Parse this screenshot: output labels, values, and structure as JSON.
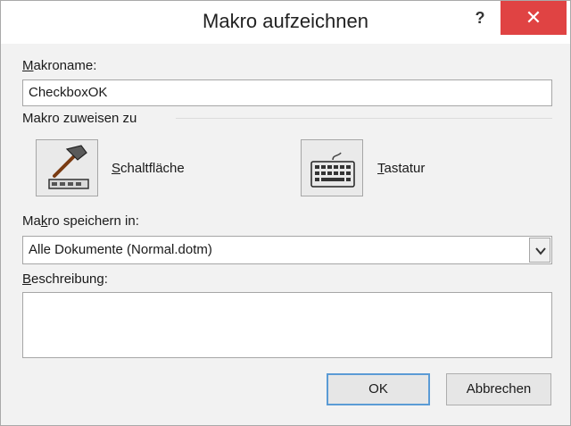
{
  "window": {
    "title": "Makro aufzeichnen",
    "help_glyph": "?",
    "close_glyph": "✕"
  },
  "macro_name": {
    "label_u": "M",
    "label_rest": "akroname:",
    "value": "CheckboxOK"
  },
  "assign": {
    "section_label": "Makro zuweisen zu",
    "button_label_u": "S",
    "button_label_rest": "chaltfläche",
    "keyboard_label_u": "T",
    "keyboard_label_rest": "astatur",
    "button_icon": "hammer-button-icon",
    "keyboard_icon": "keyboard-icon"
  },
  "store_in": {
    "label_pre": "Ma",
    "label_u": "k",
    "label_rest": "ro speichern in:",
    "selected": "Alle Dokumente (Normal.dotm)"
  },
  "description": {
    "label_u": "B",
    "label_rest": "eschreibung:",
    "value": ""
  },
  "footer": {
    "ok_label": "OK",
    "cancel_label": "Abbrechen"
  },
  "colors": {
    "close_button": "#e04343",
    "default_button_border": "#5b9bd5"
  }
}
